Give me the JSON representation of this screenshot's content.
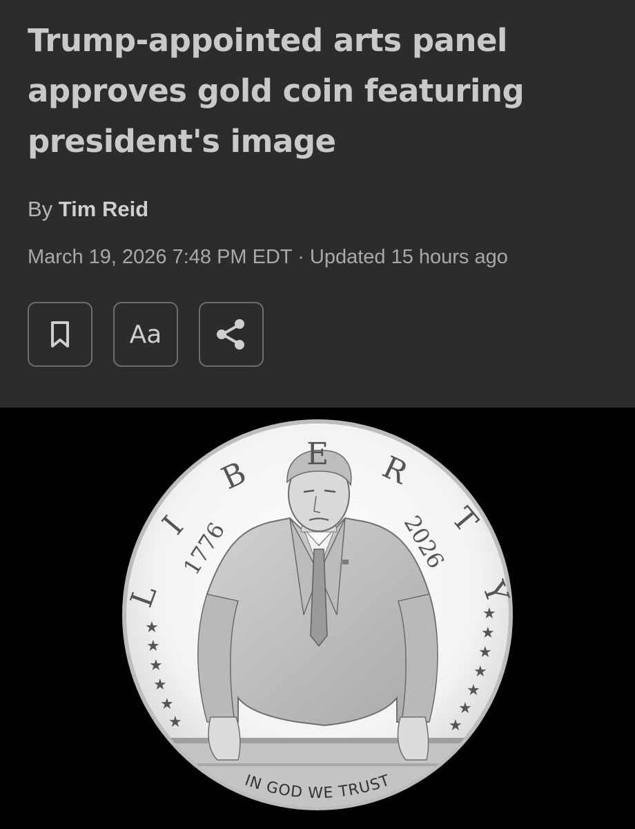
{
  "article": {
    "headline": "Trump-appointed arts panel approves gold coin featuring president's image",
    "byline_prefix": "By ",
    "author": "Tim Reid",
    "dateline": "March 19, 2026 7:48 PM EDT · Updated 15 hours ago"
  },
  "toolbar": {
    "bookmark_icon": "bookmark-icon",
    "text_size_label": "Aa",
    "share_icon": "share-icon"
  },
  "coin": {
    "rim_letters": [
      "L",
      "I",
      "B",
      "E",
      "R",
      "T",
      "Y"
    ],
    "year_left": "1776",
    "year_right": "2026",
    "motto": "IN GOD WE TRUST"
  }
}
